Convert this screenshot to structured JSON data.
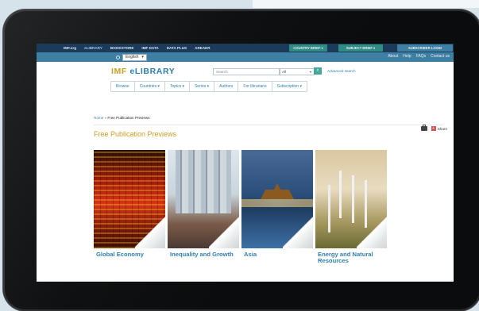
{
  "topnav": {
    "links": [
      "IMF.org",
      "eLIBRARY",
      "BOOKSTORE",
      "IMF DATA",
      "DATA PLUS",
      "AREAER"
    ],
    "dropdowns": [
      "COUNTRY BRIEF ▾",
      "SUBJECT BRIEF ▾",
      "SUBSCRIBER LOGIN"
    ]
  },
  "subbar": {
    "language": "English",
    "links": [
      "About",
      "Help",
      "FAQs",
      "Contact us"
    ]
  },
  "header": {
    "logo_imf": "IMF",
    "logo_elibrary": "eLIBRARY",
    "search_placeholder": "Search",
    "search_scope": "All",
    "advanced_search": "Advanced search"
  },
  "menu": [
    "Browse",
    "Countries ▾",
    "Topics ▾",
    "Series ▾",
    "Authors",
    "For librarians",
    "Subscription ▾"
  ],
  "breadcrumb": {
    "home": "Home",
    "sep": "»",
    "current": "Free Publication Previews"
  },
  "page_title": "Free Publication Previews",
  "share_label": "Share",
  "tiles": [
    {
      "label": "Global Economy"
    },
    {
      "label": "Inequality and Growth"
    },
    {
      "label": "Asia"
    },
    {
      "label": "Energy and Natural Resources"
    }
  ],
  "colors": {
    "nav": "#1c3a5a",
    "accent": "#2f7fb0",
    "gold": "#c9a028",
    "teal": "#2f8d86"
  }
}
